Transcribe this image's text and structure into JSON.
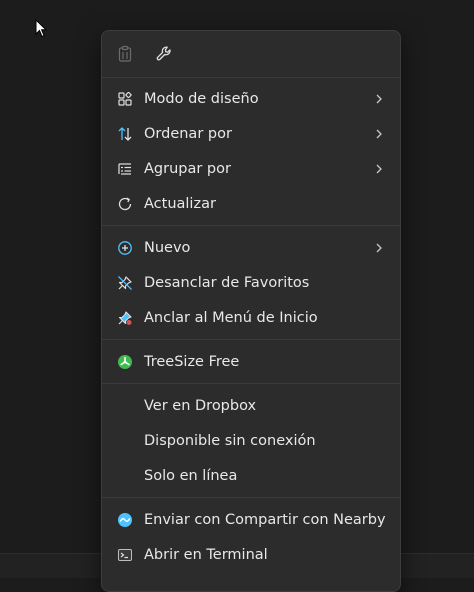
{
  "menu": {
    "items": [
      {
        "label": "Modo de diseño",
        "icon": "layout-grid-icon",
        "submenu": true
      },
      {
        "label": "Ordenar por",
        "icon": "sort-arrows-icon",
        "submenu": true
      },
      {
        "label": "Agrupar por",
        "icon": "group-list-icon",
        "submenu": true
      },
      {
        "label": "Actualizar",
        "icon": "refresh-icon",
        "submenu": false
      },
      {
        "label": "Nuevo",
        "icon": "new-plus-icon",
        "submenu": true
      },
      {
        "label": "Desanclar de Favoritos",
        "icon": "unpin-icon",
        "submenu": false
      },
      {
        "label": "Anclar al Menú de Inicio",
        "icon": "pin-start-icon",
        "submenu": false
      },
      {
        "label": "TreeSize Free",
        "icon": "treesize-icon",
        "submenu": false
      },
      {
        "label": "Ver en Dropbox",
        "icon": "",
        "submenu": false
      },
      {
        "label": "Disponible sin conexión",
        "icon": "",
        "submenu": false
      },
      {
        "label": "Solo en línea",
        "icon": "",
        "submenu": false
      },
      {
        "label": "Enviar con Compartir con Nearby",
        "icon": "nearby-share-icon",
        "submenu": false
      },
      {
        "label": "Abrir en Terminal",
        "icon": "terminal-icon",
        "submenu": false
      }
    ]
  },
  "toolbar": {
    "icons": [
      "paste-icon",
      "wrench-icon"
    ]
  },
  "colors": {
    "menu_bg": "#2c2c2c",
    "text": "#e8e8e8",
    "accent_blue": "#4cc2ff",
    "treesize_green": "#3fb950"
  }
}
